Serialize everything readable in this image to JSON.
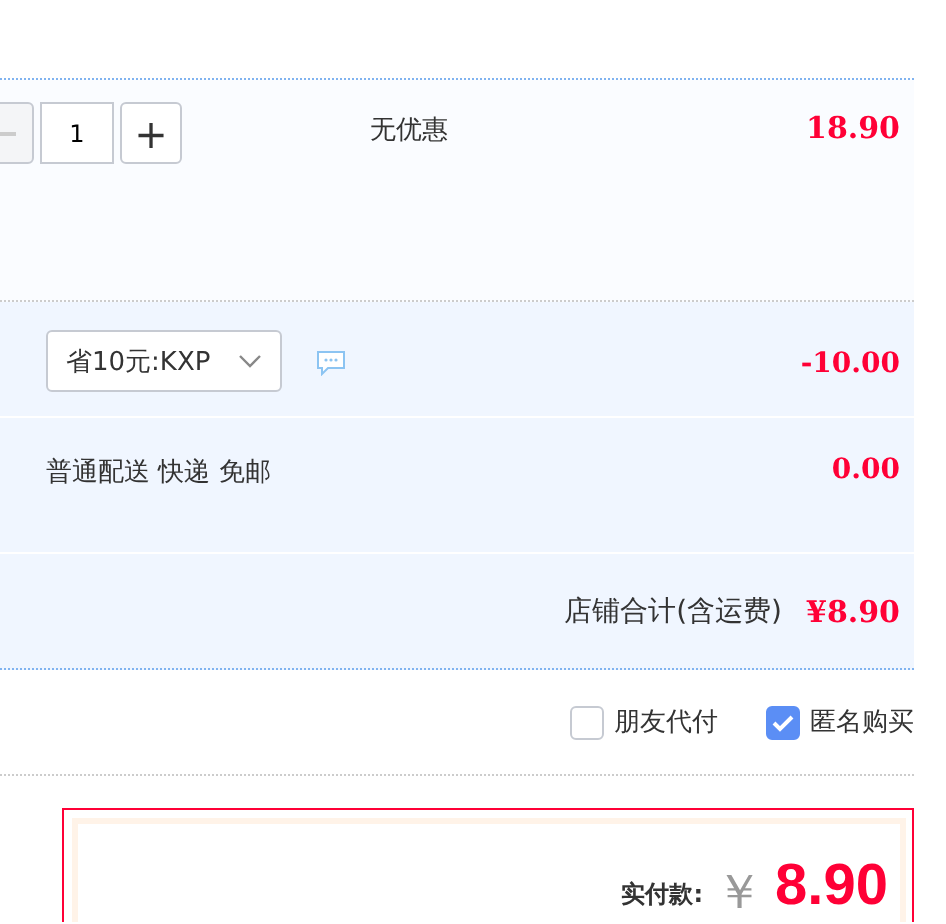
{
  "item": {
    "quantity": "1",
    "plus": "+",
    "promo": "无优惠",
    "price": "18.90"
  },
  "coupon": {
    "select": "省10元:KXP",
    "amount": "-10.00"
  },
  "delivery": {
    "text": "普通配送 快递 免邮",
    "amount": "0.00"
  },
  "total": {
    "label": "店铺合计(含运费)",
    "amount": "¥8.90"
  },
  "options": [
    {
      "label": "朋友代付",
      "checked": false
    },
    {
      "label": "匿名购买",
      "checked": true
    }
  ],
  "payment": {
    "label": "实付款:",
    "currency": "￥",
    "amount": "8.90"
  }
}
